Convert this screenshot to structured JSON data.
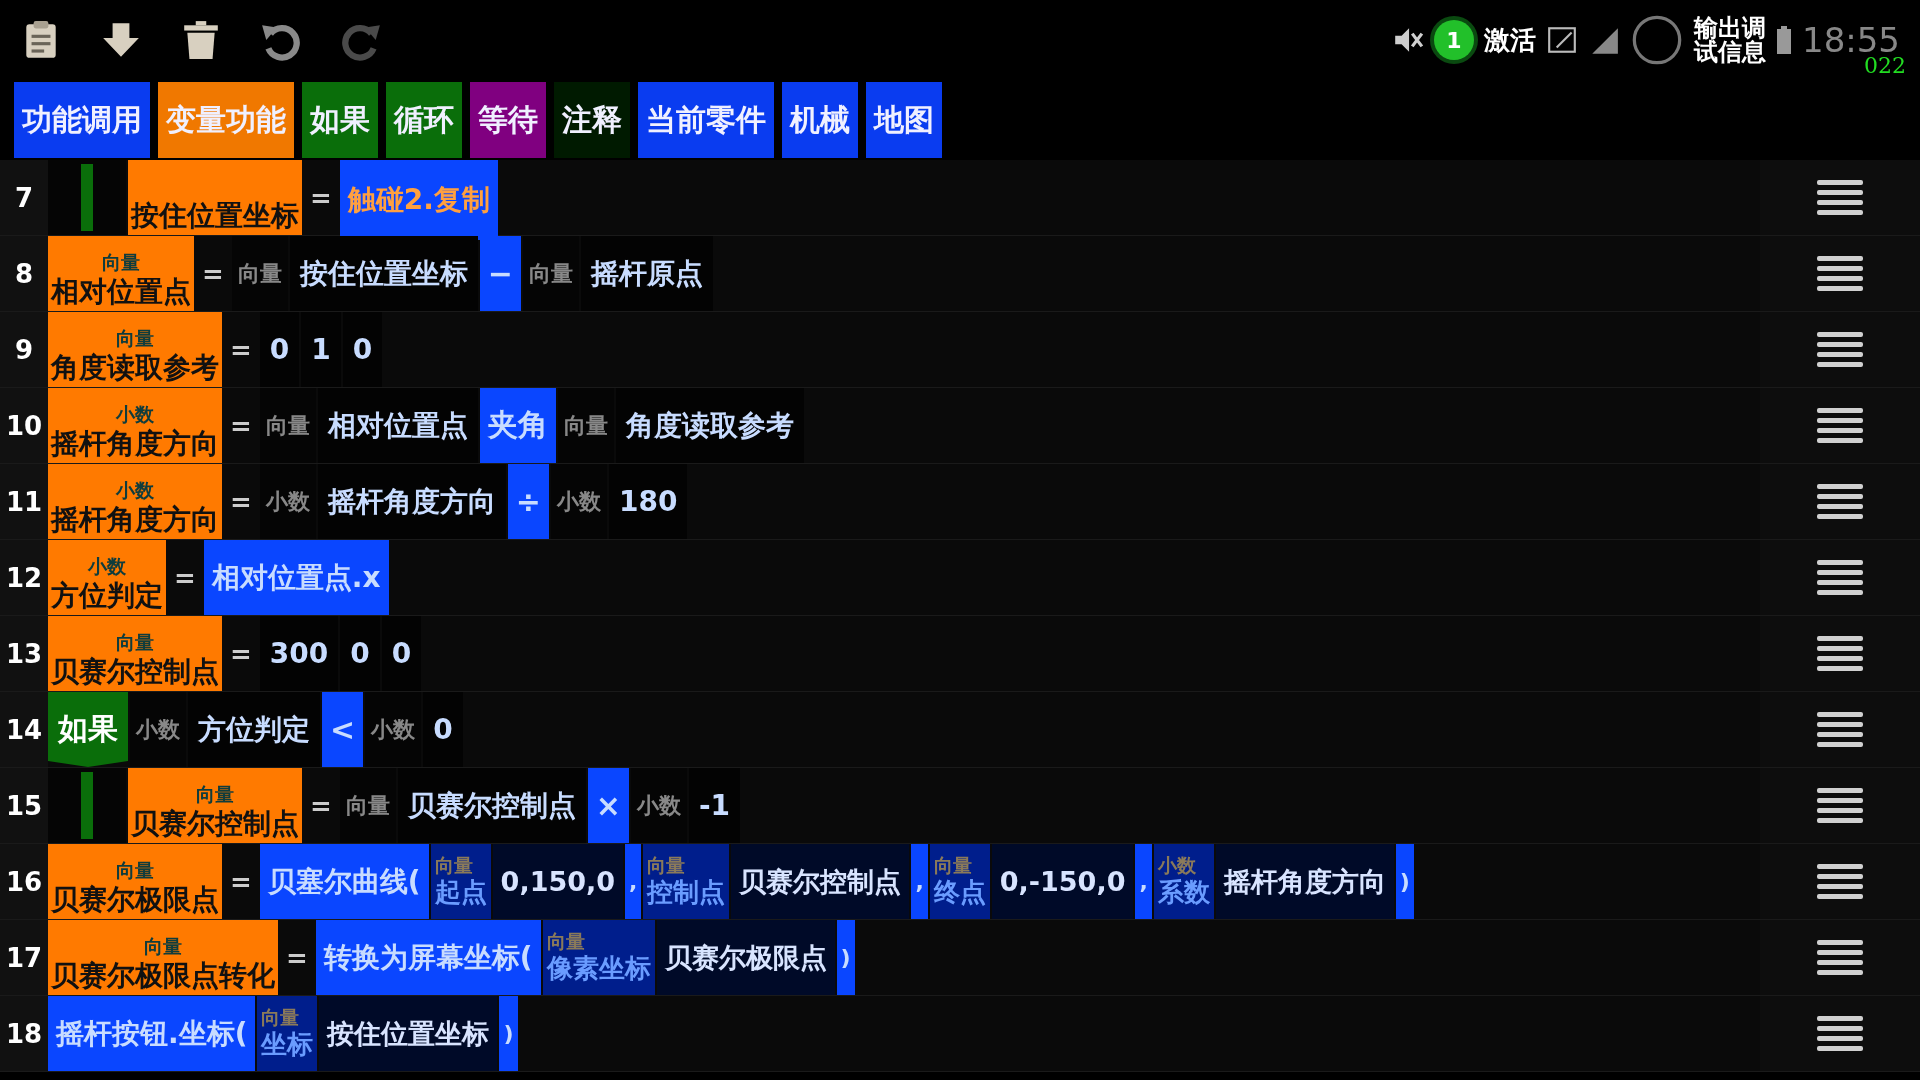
{
  "status_bar": {
    "activate_label": "激活",
    "badge": "1",
    "debug_label": "输出调试信息",
    "time": "18:55",
    "overlay": "022"
  },
  "tabs": [
    {
      "label": "功能调用",
      "color": "#0a3cf0"
    },
    {
      "label": "变量功能",
      "color": "#f07800"
    },
    {
      "label": "如果",
      "color": "#0a6e0a"
    },
    {
      "label": "循环",
      "color": "#0a6e0a"
    },
    {
      "label": "等待",
      "color": "#800080"
    },
    {
      "label": "注释",
      "color": "#001a00"
    },
    {
      "label": "当前零件",
      "color": "#0a3cf0"
    },
    {
      "label": "机械",
      "color": "#0a3cf0"
    },
    {
      "label": "地图",
      "color": "#0a3cf0"
    }
  ],
  "rows": [
    {
      "number": "7",
      "indent": true,
      "tokens": [
        {
          "kind": "var",
          "name": "按住位置坐标"
        },
        {
          "kind": "eq",
          "text": "="
        },
        {
          "kind": "expr",
          "text": "触碰2.复制"
        }
      ]
    },
    {
      "number": "8",
      "indent": false,
      "tokens": [
        {
          "kind": "var",
          "type": "向量",
          "name": "相对位置点"
        },
        {
          "kind": "eq",
          "text": "="
        },
        {
          "kind": "type",
          "text": "向量"
        },
        {
          "kind": "value",
          "text": "按住位置坐标"
        },
        {
          "kind": "op",
          "text": "−"
        },
        {
          "kind": "type",
          "text": "向量"
        },
        {
          "kind": "value",
          "text": "摇杆原点"
        }
      ]
    },
    {
      "number": "9",
      "indent": false,
      "tokens": [
        {
          "kind": "var",
          "type": "向量",
          "name": "角度读取参考"
        },
        {
          "kind": "eq",
          "text": "="
        },
        {
          "kind": "value",
          "text": "0"
        },
        {
          "kind": "value",
          "text": "1"
        },
        {
          "kind": "value",
          "text": "0"
        }
      ]
    },
    {
      "number": "10",
      "indent": false,
      "tokens": [
        {
          "kind": "var",
          "type": "小数",
          "name": "摇杆角度方向"
        },
        {
          "kind": "eq",
          "text": "="
        },
        {
          "kind": "type",
          "text": "向量"
        },
        {
          "kind": "value",
          "text": "相对位置点"
        },
        {
          "kind": "op",
          "text": "夹角"
        },
        {
          "kind": "type",
          "text": "向量"
        },
        {
          "kind": "value",
          "text": "角度读取参考"
        }
      ]
    },
    {
      "number": "11",
      "indent": false,
      "tokens": [
        {
          "kind": "var",
          "type": "小数",
          "name": "摇杆角度方向"
        },
        {
          "kind": "eq",
          "text": "="
        },
        {
          "kind": "type",
          "text": "小数"
        },
        {
          "kind": "value",
          "text": "摇杆角度方向"
        },
        {
          "kind": "op",
          "text": "÷"
        },
        {
          "kind": "type",
          "text": "小数"
        },
        {
          "kind": "value",
          "text": "180"
        }
      ]
    },
    {
      "number": "12",
      "indent": false,
      "tokens": [
        {
          "kind": "var",
          "type": "小数",
          "name": "方位判定"
        },
        {
          "kind": "eq",
          "text": "="
        },
        {
          "kind": "expr",
          "text": "相对位置点.x"
        }
      ]
    },
    {
      "number": "13",
      "indent": false,
      "tokens": [
        {
          "kind": "var",
          "type": "向量",
          "name": "贝赛尔控制点"
        },
        {
          "kind": "eq",
          "text": "="
        },
        {
          "kind": "value",
          "text": "300"
        },
        {
          "kind": "value",
          "text": "0"
        },
        {
          "kind": "value",
          "text": "0"
        }
      ]
    },
    {
      "number": "14",
      "indent": false,
      "tokens": [
        {
          "kind": "if",
          "text": "如果"
        },
        {
          "kind": "type",
          "text": "小数"
        },
        {
          "kind": "value",
          "text": "方位判定"
        },
        {
          "kind": "op",
          "text": "<"
        },
        {
          "kind": "type",
          "text": "小数"
        },
        {
          "kind": "value",
          "text": "0"
        }
      ]
    },
    {
      "number": "15",
      "indent": true,
      "tokens": [
        {
          "kind": "var",
          "type": "向量",
          "name": "贝赛尔控制点"
        },
        {
          "kind": "eq",
          "text": "="
        },
        {
          "kind": "type",
          "text": "向量"
        },
        {
          "kind": "value",
          "text": "贝赛尔控制点"
        },
        {
          "kind": "op",
          "text": "×"
        },
        {
          "kind": "type",
          "text": "小数"
        },
        {
          "kind": "value",
          "text": "-1"
        }
      ]
    },
    {
      "number": "16",
      "indent": false,
      "tokens": [
        {
          "kind": "var",
          "type": "向量",
          "name": "贝赛尔极限点"
        },
        {
          "kind": "eq",
          "text": "="
        },
        {
          "kind": "func",
          "text": "贝塞尔曲线("
        },
        {
          "kind": "param",
          "type": "向量",
          "name": "起点"
        },
        {
          "kind": "arg",
          "text": "0,150,0"
        },
        {
          "kind": "sep",
          "text": ","
        },
        {
          "kind": "param",
          "type": "向量",
          "name": "控制点"
        },
        {
          "kind": "arg",
          "text": "贝赛尔控制点"
        },
        {
          "kind": "sep",
          "text": ","
        },
        {
          "kind": "param",
          "type": "向量",
          "name": "终点"
        },
        {
          "kind": "arg",
          "text": "0,-150,0"
        },
        {
          "kind": "sep",
          "text": ","
        },
        {
          "kind": "param",
          "type": "小数",
          "name": "系数"
        },
        {
          "kind": "arg",
          "text": "摇杆角度方向"
        },
        {
          "kind": "sep",
          "text": ")"
        }
      ]
    },
    {
      "number": "17",
      "indent": false,
      "tokens": [
        {
          "kind": "var",
          "type": "向量",
          "name": "贝赛尔极限点转化"
        },
        {
          "kind": "eq",
          "text": "="
        },
        {
          "kind": "func",
          "text": "转换为屏幕坐标("
        },
        {
          "kind": "param",
          "type": "向量",
          "name": "像素坐标"
        },
        {
          "kind": "arg",
          "text": "贝赛尔极限点"
        },
        {
          "kind": "sep",
          "text": ")"
        }
      ]
    },
    {
      "number": "18",
      "indent": false,
      "tokens": [
        {
          "kind": "func",
          "text": "摇杆按钮.坐标("
        },
        {
          "kind": "param",
          "type": "向量",
          "name": "坐标"
        },
        {
          "kind": "arg",
          "text": "按住位置坐标"
        },
        {
          "kind": "sep",
          "text": ")"
        }
      ]
    }
  ]
}
